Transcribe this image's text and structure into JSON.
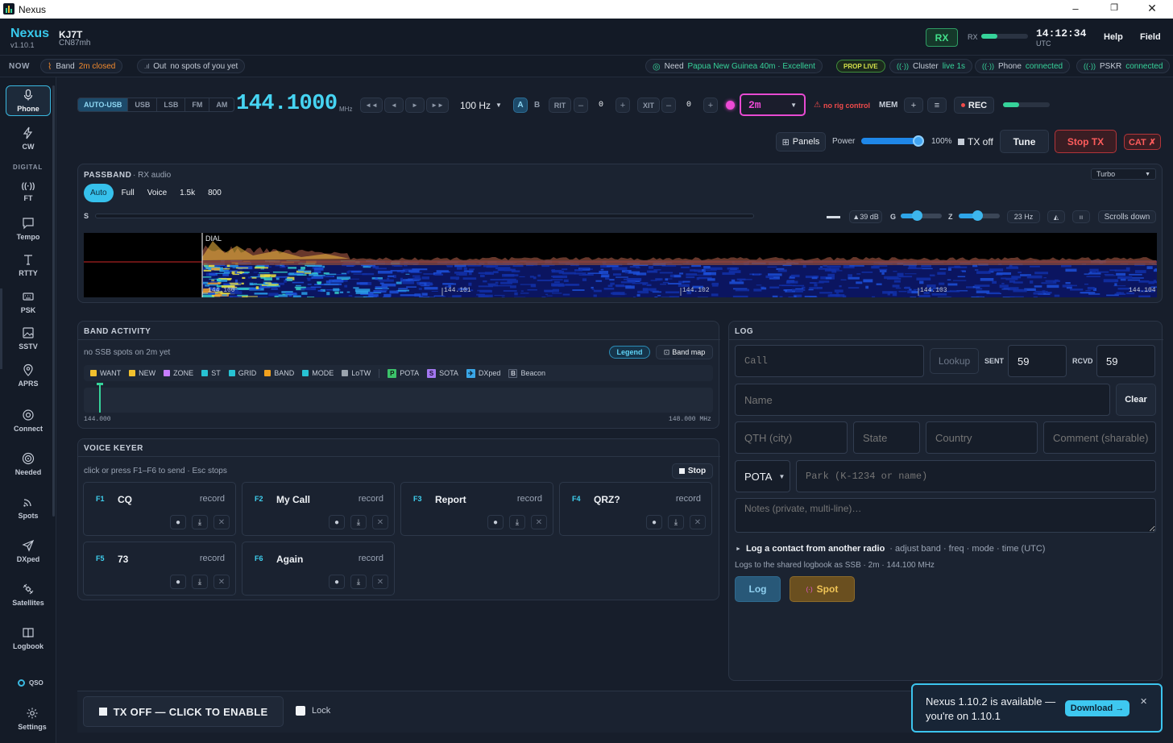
{
  "window": {
    "title": "Nexus"
  },
  "header": {
    "app_name": "Nexus",
    "version": "v1.10.1",
    "callsign": "KJ7T",
    "grid": "CN87mh",
    "rx_badge": "RX",
    "rx_meter_label": "RX",
    "clock_time": "14:12:34",
    "clock_tz": "UTC",
    "help": "Help",
    "field": "Field"
  },
  "status_bar": {
    "now_label": "NOW",
    "band_label": "Band",
    "band_value": "2m closed",
    "out_label": "Out",
    "out_value": "no spots of you yet",
    "need_label": "Need",
    "need_value": "Papua New Guinea 40m · Excellent",
    "prop_badge": "PROP LIVE",
    "cluster_label": "Cluster",
    "cluster_value": "live 1s",
    "phone_label": "Phone",
    "phone_value": "connected",
    "pskr_label": "PSKR",
    "pskr_value": "connected"
  },
  "sidebar": {
    "items": [
      {
        "label": "Phone",
        "icon": "microphone-icon"
      },
      {
        "label": "CW",
        "icon": "lightning-icon"
      },
      {
        "label": "FT",
        "icon": "broadcast-icon"
      },
      {
        "label": "Tempo",
        "icon": "chat-icon"
      },
      {
        "label": "RTTY",
        "icon": "text-icon"
      },
      {
        "label": "PSK",
        "icon": "keyboard-icon"
      },
      {
        "label": "SSTV",
        "icon": "image-icon"
      },
      {
        "label": "APRS",
        "icon": "location-pin-icon"
      },
      {
        "label": "Connect",
        "icon": "connect-icon"
      },
      {
        "label": "Needed",
        "icon": "target-icon"
      },
      {
        "label": "Spots",
        "icon": "rss-icon"
      },
      {
        "label": "DXped",
        "icon": "plane-icon"
      },
      {
        "label": "Satellites",
        "icon": "satellite-icon"
      },
      {
        "label": "Logbook",
        "icon": "book-icon"
      }
    ],
    "digital_heading": "DIGITAL",
    "qso_label": "QSO",
    "settings_label": "Settings"
  },
  "radio": {
    "modes": [
      "AUTO-USB",
      "USB",
      "LSB",
      "FM",
      "AM"
    ],
    "frequency": "144.1000",
    "freq_unit": "MHz",
    "step": "100 Hz",
    "vfo_a": "A",
    "vfo_b": "B",
    "rit_label": "RIT",
    "rit_value": "0",
    "xit_label": "XIT",
    "xit_value": "0",
    "band": "2m",
    "rig_warning": "no rig control",
    "mem_label": "MEM",
    "rec_label": "REC",
    "rec_level": 0.35,
    "panels_label": "Panels",
    "power_label": "Power",
    "power_value": "100%",
    "tx_off": "TX off",
    "tune": "Tune",
    "stop_tx": "Stop TX",
    "cat": "CAT ✗"
  },
  "passband": {
    "title": "PASSBAND",
    "subtitle": "· RX audio",
    "filters": [
      "Auto",
      "Full",
      "Voice",
      "1.5k",
      "800"
    ],
    "speed": "Turbo",
    "s_label": "S",
    "db": "▲39 dB",
    "g_label": "G",
    "g_level": 0.4,
    "z_label": "Z",
    "z_level": 0.45,
    "hz": "23 Hz",
    "scroll": "Scrolls down",
    "dial_label": "DIAL",
    "ticks": [
      "144.100",
      "144.101",
      "144.102",
      "144.103",
      "144.104"
    ]
  },
  "band_activity": {
    "title": "BAND ACTIVITY",
    "message": "no SSB spots on 2m yet",
    "legend_btn": "Legend",
    "bandmap_btn": "Band map",
    "legend": [
      {
        "label": "WANT",
        "color": "#f2c12e"
      },
      {
        "label": "NEW",
        "color": "#f2c12e"
      },
      {
        "label": "ZONE",
        "color": "#c77dff"
      },
      {
        "label": "ST",
        "color": "#27c2d3"
      },
      {
        "label": "GRID",
        "color": "#27c2d3"
      },
      {
        "label": "BAND",
        "color": "#f2a11e"
      },
      {
        "label": "MODE",
        "color": "#27c2d3"
      },
      {
        "label": "LoTW",
        "color": "#9aa3ad"
      }
    ],
    "tags": [
      {
        "letter": "P",
        "label": "POTA",
        "color": "#3cc26a"
      },
      {
        "letter": "S",
        "label": "SOTA",
        "color": "#a377f0"
      },
      {
        "letter": "✈",
        "label": "DXped",
        "color": "#3aa7e8"
      },
      {
        "letter": "B",
        "label": "Beacon",
        "color": "#2a3242"
      }
    ],
    "range_start": "144.000",
    "range_end": "148.000 MHz"
  },
  "voice_keyer": {
    "title": "VOICE KEYER",
    "hint": "click or press F1–F6 to send · Esc stops",
    "stop": "Stop",
    "record_label": "record",
    "keys": [
      {
        "key": "F1",
        "name": "CQ"
      },
      {
        "key": "F2",
        "name": "My Call"
      },
      {
        "key": "F3",
        "name": "Report"
      },
      {
        "key": "F4",
        "name": "QRZ?"
      },
      {
        "key": "F5",
        "name": "73"
      },
      {
        "key": "F6",
        "name": "Again"
      }
    ]
  },
  "log": {
    "title": "LOG",
    "call_placeholder": "Call",
    "lookup": "Lookup",
    "sent_label": "SENT",
    "sent_value": "59",
    "rcvd_label": "RCVD",
    "rcvd_value": "59",
    "name_placeholder": "Name",
    "clear": "Clear",
    "qth_placeholder": "QTH (city)",
    "state_placeholder": "State",
    "country_placeholder": "Country",
    "comment_placeholder": "Comment (sharable)",
    "program": "POTA",
    "park_placeholder": "Park (K-1234 or name)",
    "notes_placeholder": "Notes (private, multi-line)…",
    "other_radio": "Log a contact from another radio",
    "other_radio_sub": "· adjust band · freq · mode · time (UTC)",
    "info": "Logs to the shared logbook as SSB · 2m · 144.100 MHz",
    "log_btn": "Log",
    "spot_btn": "Spot"
  },
  "footer": {
    "tx_button": "TX OFF — CLICK TO ENABLE",
    "lock": "Lock"
  },
  "toast": {
    "line1": "Nexus 1.10.2 is available —",
    "line2": "you're on 1.10.1",
    "download": "Download →"
  }
}
